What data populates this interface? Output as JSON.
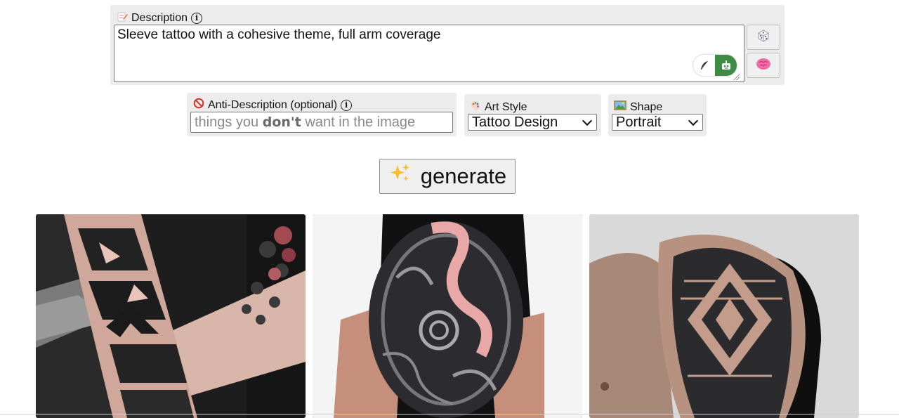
{
  "description": {
    "label": "Description",
    "icon": "pencil-paper-icon",
    "value": "Sleeve tattoo with a cohesive theme, full arm coverage",
    "side_buttons": [
      {
        "icon": "dice-icon"
      },
      {
        "icon": "brain-icon"
      }
    ],
    "mode_toggle": {
      "left_icon": "quill-icon",
      "right_icon": "robot-icon",
      "active_color": "#3d8b45"
    }
  },
  "anti_description": {
    "label": "Anti-Description (optional)",
    "icon": "no-entry-icon",
    "placeholder_before": "things you ",
    "placeholder_bold": "don't",
    "placeholder_after": " want in the image",
    "value": ""
  },
  "art_style": {
    "label": "Art Style",
    "icon": "palette-icon",
    "selected": "Tattoo Design"
  },
  "shape": {
    "label": "Shape",
    "icon": "framed-picture-icon",
    "selected": "Portrait"
  },
  "generate": {
    "icon": "sparkles-icon",
    "label": "generate"
  },
  "results": [
    {
      "alt_icon": "tattoo-image-1"
    },
    {
      "alt_icon": "tattoo-image-2"
    },
    {
      "alt_icon": "tattoo-image-3"
    }
  ]
}
